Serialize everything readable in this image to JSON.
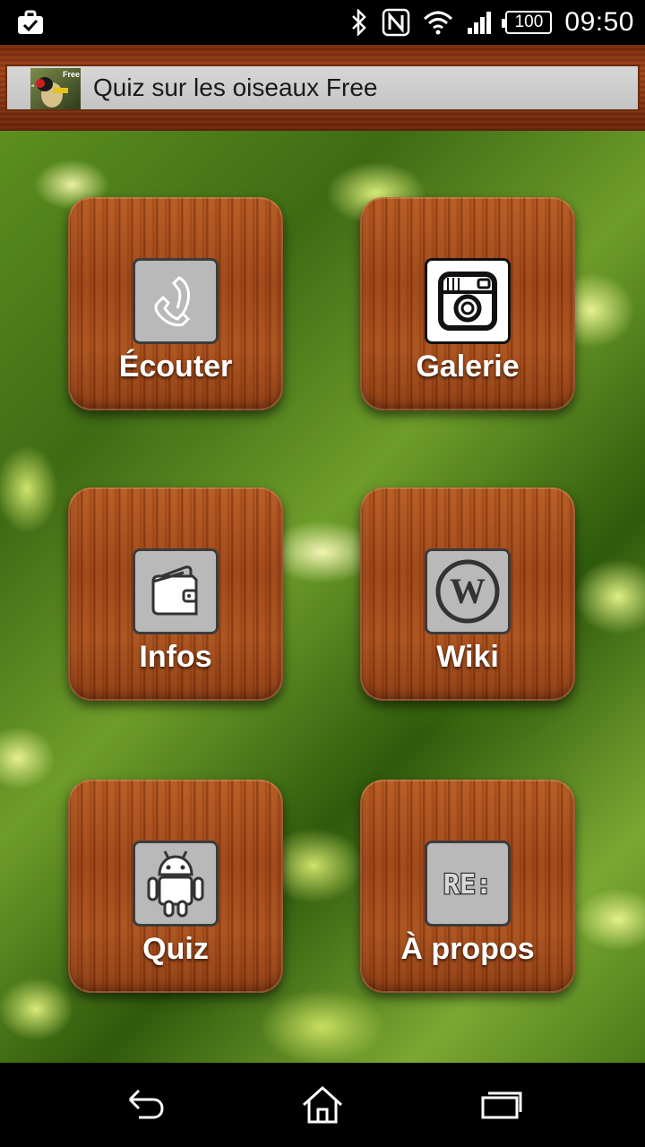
{
  "status_bar": {
    "battery_level": "100",
    "time": "09:50",
    "icons": [
      "briefcase-icon",
      "bluetooth-icon",
      "nfc-icon",
      "wifi-icon",
      "signal-icon",
      "battery-icon"
    ]
  },
  "app_bar": {
    "title": "Quiz sur les oiseaux Free",
    "app_icon_badge": "Free"
  },
  "menu": {
    "items": [
      {
        "label": "Écouter",
        "icon": "phone-icon"
      },
      {
        "label": "Galerie",
        "icon": "camera-icon"
      },
      {
        "label": "Infos",
        "icon": "wallet-icon"
      },
      {
        "label": "Wiki",
        "icon": "wordpress-icon"
      },
      {
        "label": "Quiz",
        "icon": "android-icon"
      },
      {
        "label": "À propos",
        "icon": "re-icon"
      }
    ]
  },
  "re_icon_text": "RE:",
  "navigation": {
    "buttons": [
      "back-icon",
      "home-icon",
      "recent-apps-icon"
    ]
  },
  "colors": {
    "wood": "#9c4416",
    "tile_icon_bg": "#b9b9b9",
    "title_panel": "#cfcfcf",
    "foliage": "#4a7a18"
  }
}
